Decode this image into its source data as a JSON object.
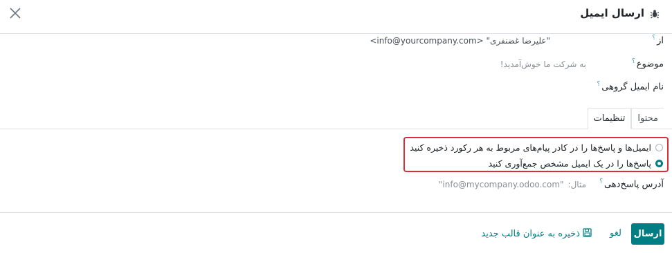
{
  "dialog": {
    "title": "ارسال ایمیل",
    "bug_icon": "bug-icon",
    "close_icon": "close-icon"
  },
  "fields": {
    "from": {
      "label": "از",
      "value": "\"علیرضا غضنفری\" <info@yourcompany.com>"
    },
    "subject": {
      "label": "موضوع",
      "placeholder": "به شرکت ما خوش‌آمدید!"
    },
    "mass_mailing_name": {
      "label": "نام ایمیل گروهی"
    },
    "help_marker": "؟"
  },
  "tabs": [
    {
      "label": "محتوا",
      "active": false
    },
    {
      "label": "تنظیمات",
      "active": true
    }
  ],
  "settings": {
    "options": [
      {
        "label": "ایمیل‌ها و پاسخ‌ها را در کادر پیام‌های مربوط به هر رکورد ذخیره کنید",
        "checked": false
      },
      {
        "label": "پاسخ‌ها را در یک ایمیل مشخص جمع‌آوری کنید",
        "checked": true
      }
    ],
    "reply_to": {
      "label": "آدرس پاسخ‌دهی",
      "placeholder_prefix": "مثال:",
      "placeholder_value": "\"info@mycompany.odoo.com\""
    }
  },
  "footer": {
    "send_label": "ارسال",
    "cancel_label": "لغو",
    "save_template_label": "ذخیره به عنوان قالب جدید",
    "save_icon": "floppy-disk-icon"
  },
  "colors": {
    "accent": "#017e84",
    "highlight": "#d92d3a",
    "help": "#3aa0a3"
  }
}
